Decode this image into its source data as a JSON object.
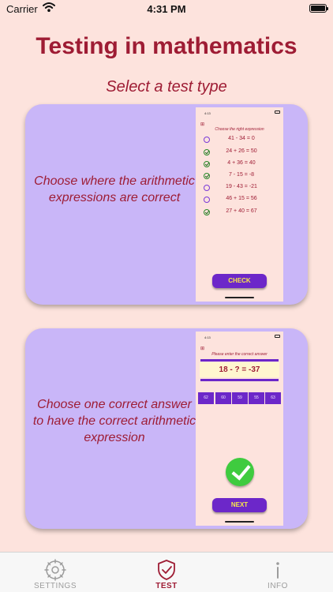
{
  "status_bar": {
    "carrier": "Carrier",
    "time": "4:31 PM"
  },
  "header": {
    "title": "Testing in mathematics",
    "subtitle": "Select a test type"
  },
  "cards": [
    {
      "description": "Choose where the arithmetic expressions are correct",
      "preview": {
        "time": "4:13",
        "grid_glyph": "⊞",
        "prompt": "Choose the right expression",
        "expressions": [
          {
            "text": "41 - 34 = 0",
            "checked": false
          },
          {
            "text": "24 + 26 = 50",
            "checked": true
          },
          {
            "text": "4 + 36 = 40",
            "checked": true
          },
          {
            "text": "7 - 15 = -8",
            "checked": true
          },
          {
            "text": "19 - 43 = -21",
            "checked": false
          },
          {
            "text": "46 + 15 = 56",
            "checked": false
          },
          {
            "text": "27 + 40 = 67",
            "checked": true
          }
        ],
        "button_label": "CHECK"
      }
    },
    {
      "description": "Choose one correct answer to have the correct arithmetic expression",
      "preview": {
        "time": "4:13",
        "grid_glyph": "⊞",
        "prompt": "Please enter the correct answer",
        "question": "18 - ? = -37",
        "options": [
          "62",
          "60",
          "59",
          "55",
          "63"
        ],
        "button_label": "NEXT"
      }
    }
  ],
  "tab_bar": {
    "tabs": [
      {
        "label": "SETTINGS",
        "icon": "gear-icon",
        "active": false
      },
      {
        "label": "TEST",
        "icon": "shield-check-icon",
        "active": true
      },
      {
        "label": "INFO",
        "icon": "info-icon",
        "active": false
      }
    ]
  },
  "colors": {
    "background": "#fde3dd",
    "card": "#c9b6f8",
    "title": "#9e1c34",
    "button": "#6c27c9",
    "button_text": "#f7e84a",
    "active_tab": "#9e1c34",
    "inactive_tab": "#9c9c9c"
  }
}
